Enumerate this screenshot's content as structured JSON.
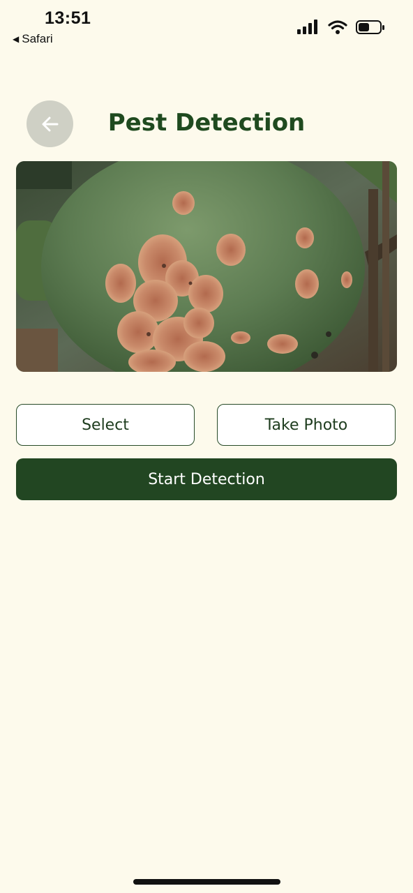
{
  "status_bar": {
    "time": "13:51",
    "back_app": "Safari",
    "icons": [
      "signal-icon",
      "wifi-icon",
      "battery-icon"
    ]
  },
  "header": {
    "title": "Pest Detection",
    "back_icon": "arrow-left-icon"
  },
  "image": {
    "subject": "citrus fruit with pest damage"
  },
  "actions": {
    "select_label": "Select",
    "take_photo_label": "Take Photo",
    "start_label": "Start Detection"
  },
  "colors": {
    "background": "#fdfaec",
    "title": "#1f4a1f",
    "primary_button": "#224622",
    "back_button_bg": "#cfd0c5"
  }
}
